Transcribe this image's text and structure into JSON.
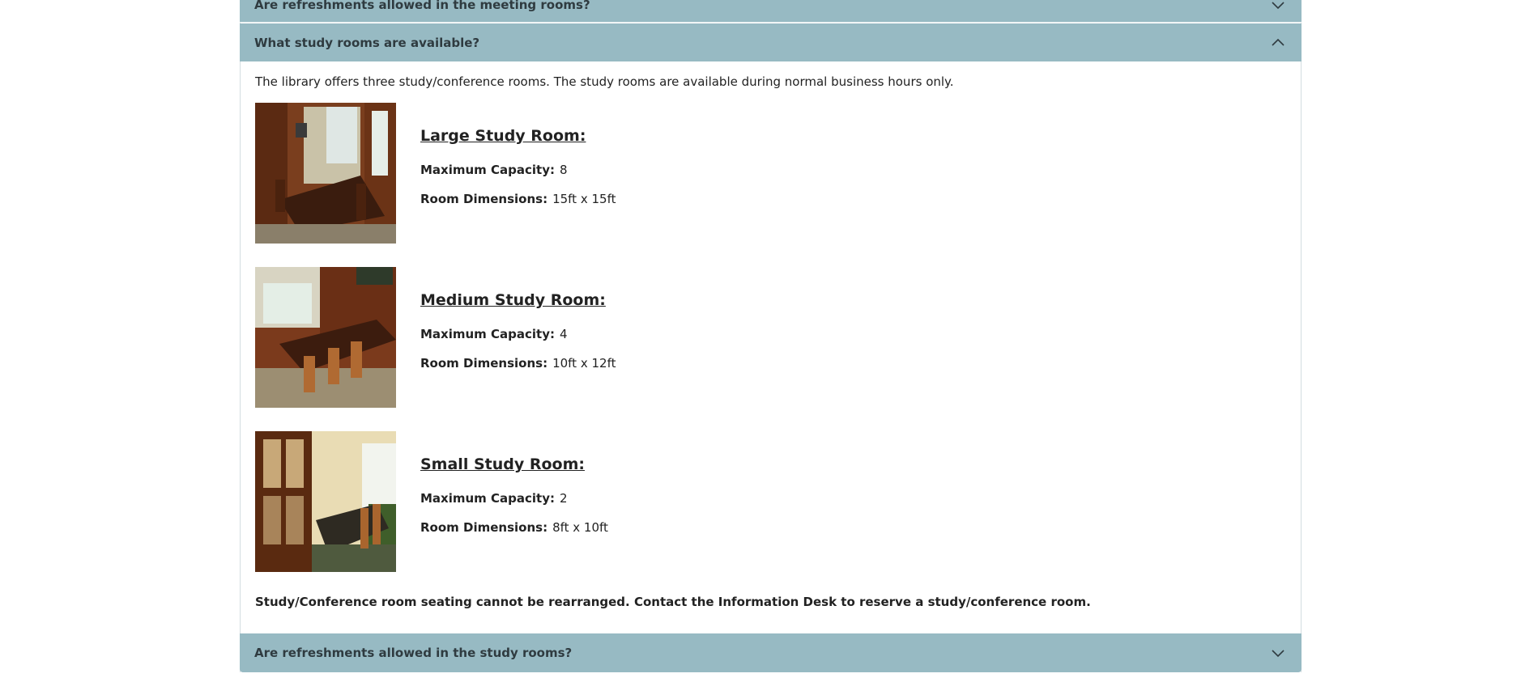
{
  "faq": {
    "meeting_refreshments": {
      "question": "Are refreshments allowed in the meeting rooms?",
      "icon": "chevron-down-icon"
    },
    "study_rooms": {
      "question": "What study rooms are available?",
      "icon": "chevron-up-icon",
      "intro": "The library offers three study/conference rooms. The study rooms are available during normal business hours only.",
      "rooms": [
        {
          "title": "Large Study Room:",
          "capacity_label": "Maximum Capacity:",
          "capacity": "8",
          "dimensions_label": "Room Dimensions:",
          "dimensions": "15ft x 15ft"
        },
        {
          "title": "Medium Study Room:",
          "capacity_label": "Maximum Capacity:",
          "capacity": "4",
          "dimensions_label": "Room Dimensions:",
          "dimensions": "10ft x 12ft"
        },
        {
          "title": "Small Study Room:",
          "capacity_label": "Maximum Capacity:",
          "capacity": "2",
          "dimensions_label": "Room Dimensions:",
          "dimensions": "8ft x 10ft"
        }
      ],
      "notice": "Study/Conference room seating cannot be rearranged. Contact the Information Desk to reserve a study/conference room."
    },
    "study_refreshments": {
      "question": "Are refreshments allowed in the study rooms?",
      "icon": "chevron-down-icon"
    }
  },
  "colors": {
    "accordion_header": "#97bac3",
    "header_text": "#2f3b40",
    "body_text": "#222222"
  }
}
